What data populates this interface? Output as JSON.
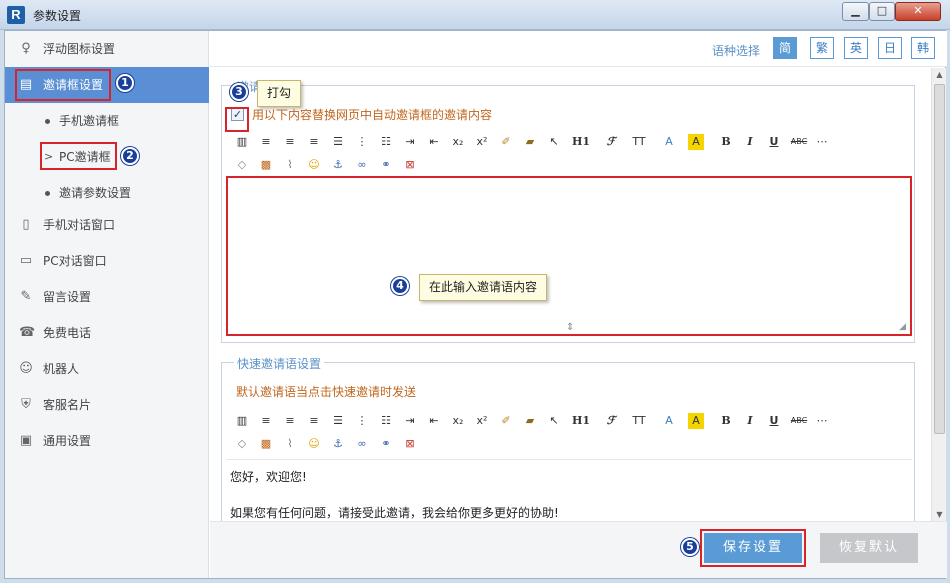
{
  "window": {
    "title": "参数设置",
    "logo": "R",
    "min_icon": "minimize-icon",
    "max_icon": "maximize-icon",
    "close_icon": "close-icon"
  },
  "sidebar": {
    "items": [
      {
        "label": "浮动图标设置",
        "icon": "lightbulb-icon"
      },
      {
        "label": "邀请框设置",
        "icon": "document-icon"
      },
      {
        "label": "手机对话窗口",
        "icon": "phone-icon"
      },
      {
        "label": "PC对话窗口",
        "icon": "monitor-icon"
      },
      {
        "label": "留言设置",
        "icon": "edit-icon"
      },
      {
        "label": "免费电话",
        "icon": "telephone-icon"
      },
      {
        "label": "机器人",
        "icon": "robot-icon"
      },
      {
        "label": "客服名片",
        "icon": "shield-icon"
      },
      {
        "label": "通用设置",
        "icon": "id-card-icon"
      }
    ],
    "sub_items": [
      {
        "label": "手机邀请框"
      },
      {
        "label": "PC邀请框"
      },
      {
        "label": "邀请参数设置"
      }
    ]
  },
  "lang": {
    "label": "语种选择",
    "options": [
      "简",
      "繁",
      "英",
      "日",
      "韩"
    ],
    "selected": "简"
  },
  "section1": {
    "legend": "邀请语设置",
    "checkbox_label": "用以下内容替换网页中自动邀请框的邀请内容",
    "checkbox_checked": true
  },
  "section2": {
    "legend": "快速邀请语设置",
    "hint": "默认邀请语当点击快速邀请时发送",
    "editor_line1": "您好，欢迎您!",
    "editor_line2": "如果您有任何问题，请接受此邀请，我会给你更多更好的协助!"
  },
  "toolbar": {
    "h1": "H1",
    "font": "ℱ",
    "size": "TT",
    "color": "A",
    "bg": "A",
    "bold": "B",
    "italic": "I",
    "underline": "U",
    "strike": "ABC",
    "sub": "x₂",
    "sup": "x²"
  },
  "annotations": {
    "n1": "1",
    "n2": "2",
    "n3": "3",
    "n4": "4",
    "n5": "5",
    "tip_check": "打勾",
    "tip_input": "在此输入邀请语内容"
  },
  "footer": {
    "save": "保存设置",
    "reset": "恢复默认"
  }
}
